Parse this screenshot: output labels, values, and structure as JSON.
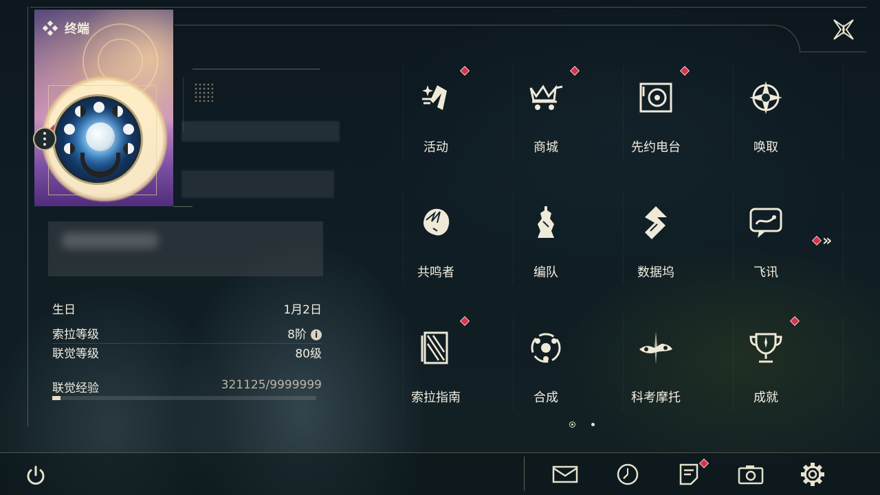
{
  "header": {
    "title": "终端"
  },
  "profile": {
    "stats": [
      {
        "key": "生日",
        "value": "1月2日"
      },
      {
        "key": "索拉等级",
        "value": "8阶"
      },
      {
        "key": "联觉等级",
        "value": "80级"
      }
    ],
    "exp": {
      "label": "联觉经验",
      "value": "321125/9999999",
      "current": 321125,
      "max": 9999999
    }
  },
  "menu": {
    "items": [
      {
        "label": "活动",
        "icon": "sparkle-activity-icon",
        "badge": true
      },
      {
        "label": "商城",
        "icon": "crown-cart-icon",
        "badge": true
      },
      {
        "label": "先约电台",
        "icon": "radio-disc-icon",
        "badge": true
      },
      {
        "label": "唤取",
        "icon": "compass-star-icon",
        "badge": false
      },
      {
        "label": "共鸣者",
        "icon": "character-portrait-icon",
        "badge": false
      },
      {
        "label": "编队",
        "icon": "chess-rook-icon",
        "badge": false
      },
      {
        "label": "数据坞",
        "icon": "data-dock-icon",
        "badge": false
      },
      {
        "label": "飞讯",
        "icon": "chat-bubble-icon",
        "badge": false
      },
      {
        "label": "索拉指南",
        "icon": "guide-book-icon",
        "badge": true
      },
      {
        "label": "合成",
        "icon": "synthesis-orbit-icon",
        "badge": false
      },
      {
        "label": "科考摩托",
        "icon": "motorbike-icon",
        "badge": false
      },
      {
        "label": "成就",
        "icon": "trophy-icon",
        "badge": true
      }
    ],
    "page": {
      "current": 1,
      "total": 2
    }
  },
  "bottom_bar": {
    "left": [
      {
        "icon": "power-icon"
      }
    ],
    "right": [
      {
        "icon": "mail-icon",
        "badge": false
      },
      {
        "icon": "clock-icon",
        "badge": false
      },
      {
        "icon": "notice-icon",
        "badge": true
      },
      {
        "icon": "camera-icon",
        "badge": false
      },
      {
        "icon": "gear-icon",
        "badge": false
      }
    ]
  },
  "colors": {
    "badge": "#d2344b",
    "text": "#f2eddf",
    "accent": "#c9b98e"
  }
}
